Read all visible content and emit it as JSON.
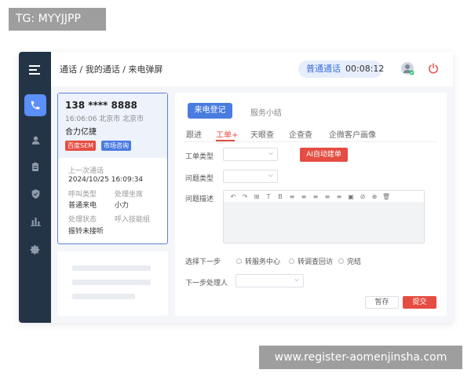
{
  "watermarks": {
    "top_left": "TG: MYYJJPP",
    "bottom_right": "www.register-aomenjinsha.com"
  },
  "header": {
    "breadcrumb": "通话 / 我的通话 / 来电弹屏",
    "call_type": "普通通话",
    "call_timer": "00:08:12"
  },
  "sidebar": {
    "items": [
      {
        "icon": "menu-icon",
        "active": false
      },
      {
        "icon": "phone-icon",
        "active": true
      },
      {
        "icon": "user-icon",
        "active": false
      },
      {
        "icon": "clipboard-icon",
        "active": false
      },
      {
        "icon": "shield-icon",
        "active": false
      },
      {
        "icon": "bar-chart-icon",
        "active": false
      },
      {
        "icon": "gear-icon",
        "active": false
      }
    ]
  },
  "caller": {
    "phone": "138 **** 8888",
    "time_location": "16:06:06  北京市 北京市",
    "company": "合力亿捷",
    "tags": [
      "百度SEM",
      "市场咨询"
    ],
    "last_call_label": "上一次通话",
    "last_call_value": "2024/10/25  16:09:34",
    "call_type_label": "呼叫类型",
    "call_type_value": "普通来电",
    "handler_label": "处理坐席",
    "handler_value": "小力",
    "status_label": "处理状态",
    "status_value": "振铃未接听",
    "skill_group_label": "呼入技能组"
  },
  "main": {
    "tabs": [
      "来电登记",
      "服务小结"
    ],
    "subtabs": [
      "跟进",
      "工单+",
      "天眼查",
      "企查查",
      "企微客户画像"
    ],
    "form": {
      "ticket_type_label": "工单类型",
      "ai_button": "AI自动建单",
      "issue_type_label": "问题类型",
      "issue_desc_label": "问题描述",
      "next_step_label": "选择下一步",
      "next_step_options": [
        "转服务中心",
        "转调查回访",
        "完结"
      ],
      "next_handler_label": "下一步处理人"
    },
    "editor_toolbar": [
      "↶",
      "↷",
      "⊞",
      "T",
      "B",
      "≡",
      "≡",
      "≡",
      "≡",
      "≡",
      "▣",
      "⊘",
      "⊕",
      "🗑"
    ],
    "save_label": "暂存",
    "submit_label": "提交"
  },
  "colors": {
    "sidebar": "#243447",
    "accent_blue": "#4a7be0",
    "accent_red": "#e54d42"
  }
}
